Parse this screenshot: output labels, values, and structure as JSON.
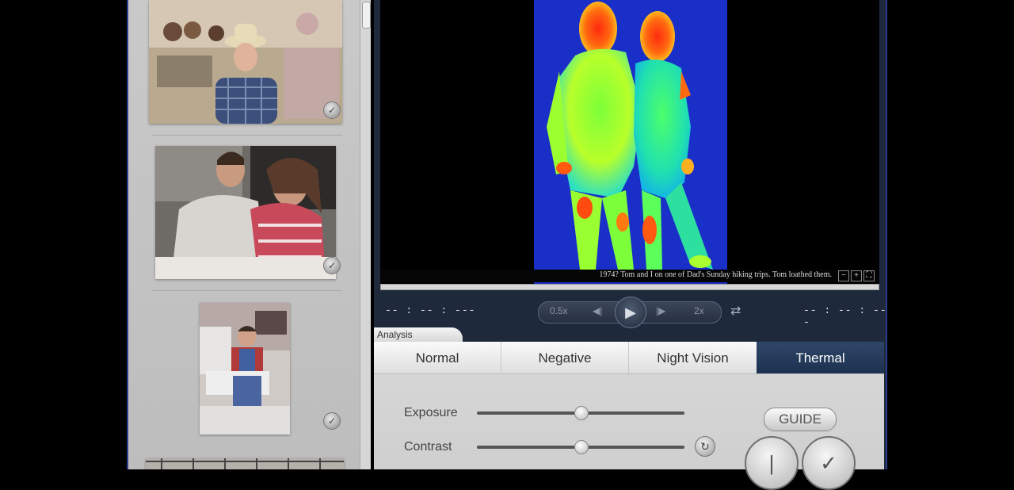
{
  "caption": "1974? Tom and I on one of Dad's Sunday hiking trips. Tom loathed them.",
  "zoom_controls": [
    "−",
    "+",
    "⛶"
  ],
  "transport": {
    "time_left": "-- : -- : ---",
    "time_right": "-- : -- : ---",
    "speed_slow": "0.5x",
    "speed_fast": "2x",
    "prev_glyph": "◀|",
    "next_glyph": "|▶",
    "play_glyph": "▶",
    "loop_glyph": "⇄"
  },
  "analysis": {
    "tab_label": "Analysis",
    "modes": [
      {
        "label": "Normal",
        "active": false
      },
      {
        "label": "Negative",
        "active": false
      },
      {
        "label": "Night Vision",
        "active": false
      },
      {
        "label": "Thermal",
        "active": true
      }
    ],
    "sliders": [
      {
        "label": "Exposure",
        "value": 0.5
      },
      {
        "label": "Contrast",
        "value": 0.5
      }
    ],
    "reset_glyph": "↻",
    "guide_label": "GUIDE",
    "ok_glyph": "✓"
  },
  "colors": {
    "accent_active_tab": "#1d3150",
    "frame_border": "#2a3a8c",
    "thermal_background": "#1a2fc8"
  }
}
